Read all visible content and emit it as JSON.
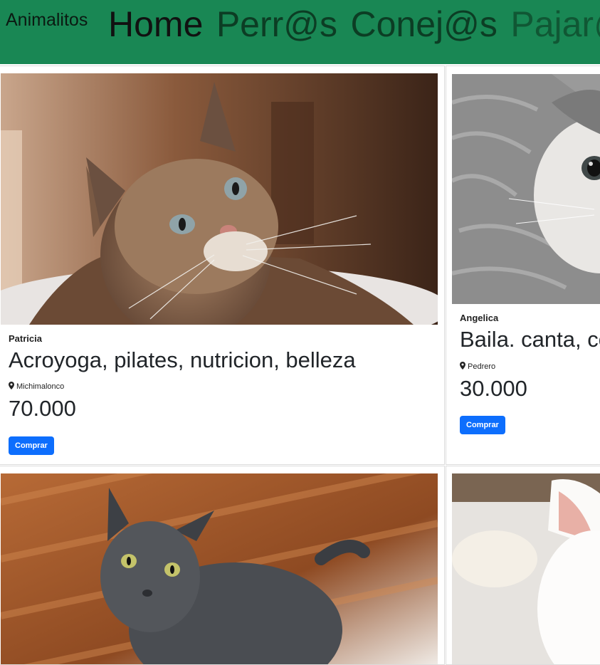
{
  "navbar": {
    "brand": "Animalitos",
    "links": [
      {
        "label": "Home",
        "active": true
      },
      {
        "label": "Perr@s"
      },
      {
        "label": "Conej@s"
      },
      {
        "label": "Pajar@s"
      }
    ]
  },
  "cards": [
    {
      "owner": "Patricia",
      "title": "Acroyoga, pilates, nutricion, belleza",
      "location": "Michimalonco",
      "price": "70.000",
      "button": "Comprar",
      "image": "tabby-cat-photo"
    },
    {
      "owner": "Angelica",
      "title": "Baila. canta, co",
      "location": "Pedrero",
      "price": "30.000",
      "button": "Comprar",
      "image": "grey-cat-in-blanket-photo"
    },
    {
      "image": "grey-cat-on-floor-photo"
    },
    {
      "image": "white-cat-photo"
    }
  ],
  "colors": {
    "navbar": "#198754",
    "button": "#0d6efd"
  }
}
